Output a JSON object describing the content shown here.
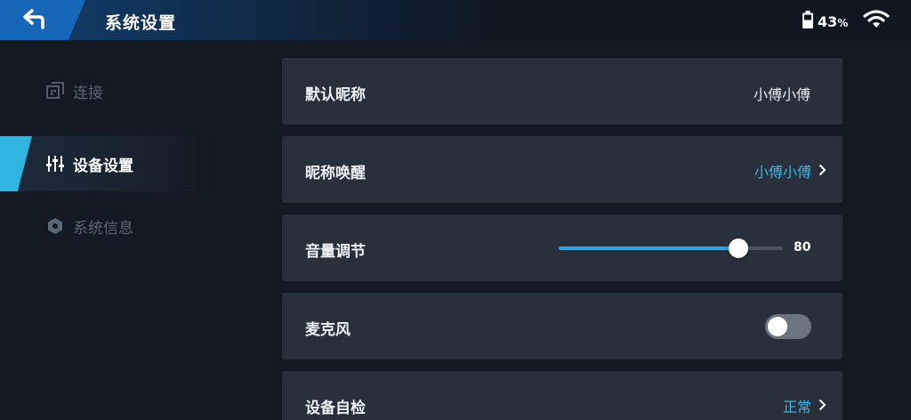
{
  "header": {
    "title": "系统设置",
    "battery_percent": "43",
    "battery_unit": "%",
    "back_icon": "back-arrow-icon",
    "battery_icon": "battery-icon",
    "wifi_icon": "wifi-icon"
  },
  "sidebar": {
    "items": [
      {
        "label": "连接",
        "icon": "connection-icon",
        "active": false
      },
      {
        "label": "设备设置",
        "icon": "sliders-icon",
        "active": true
      },
      {
        "label": "系统信息",
        "icon": "hexagon-info-icon",
        "active": false
      }
    ]
  },
  "settings": {
    "nickname": {
      "label": "默认昵称",
      "value": "小傅小傅"
    },
    "wake_word": {
      "label": "昵称唤醒",
      "value": "小傅小傅"
    },
    "volume": {
      "label": "音量调节",
      "value": "80",
      "level": 0.8
    },
    "microphone": {
      "label": "麦克风",
      "enabled": false
    },
    "self_check": {
      "label": "设备自检",
      "value": "正常"
    }
  },
  "colors": {
    "accent": "#2fb5e0",
    "link": "#3cb6e8",
    "back_button": "#1767b8",
    "card": "#27303b",
    "background": "#121922"
  }
}
